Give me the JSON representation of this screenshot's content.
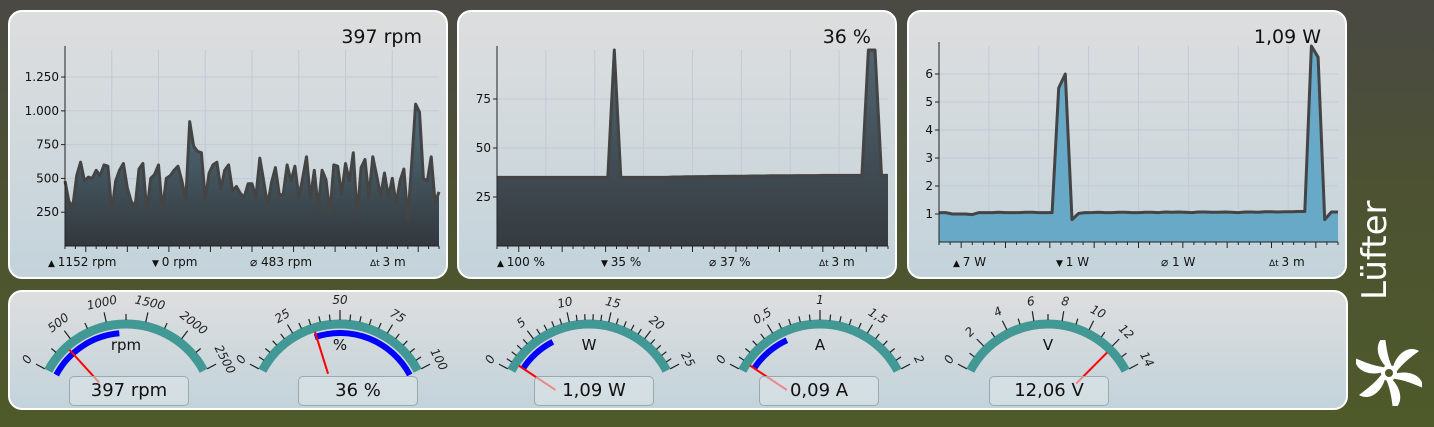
{
  "section_title": "Lüfter",
  "charts": [
    {
      "current": "397 rpm",
      "stats": {
        "max": "1152 rpm",
        "min": "0 rpm",
        "avg": "483 rpm",
        "span": "3 m"
      },
      "chart_data": {
        "type": "area",
        "ylim": [
          0,
          1450
        ],
        "yticks": [
          250,
          500,
          750,
          1000,
          1250
        ],
        "ytick_labels": [
          "250",
          "500",
          "750",
          "1.000",
          "1.250"
        ],
        "fill": [
          "#52707f",
          "#33383c"
        ],
        "values": [
          480,
          330,
          290,
          520,
          620,
          480,
          510,
          500,
          560,
          520,
          600,
          590,
          250,
          480,
          560,
          610,
          430,
          330,
          290,
          570,
          610,
          250,
          500,
          530,
          600,
          260,
          500,
          520,
          560,
          590,
          480,
          340,
          920,
          740,
          700,
          690,
          340,
          540,
          600,
          620,
          420,
          560,
          600,
          410,
          440,
          390,
          360,
          460,
          460,
          360,
          650,
          480,
          300,
          470,
          580,
          380,
          380,
          600,
          480,
          590,
          360,
          500,
          660,
          350,
          560,
          280,
          560,
          490,
          240,
          600,
          590,
          380,
          610,
          480,
          690,
          220,
          580,
          640,
          360,
          660,
          520,
          370,
          540,
          360,
          500,
          310,
          480,
          570,
          200,
          610,
          1050,
          990,
          500,
          480,
          660,
          320,
          400
        ]
      }
    },
    {
      "current": "36 %",
      "stats": {
        "max": "100 %",
        "min": "35 %",
        "avg": "37 %",
        "span": "3 m"
      },
      "chart_data": {
        "type": "area",
        "ylim": [
          0,
          100
        ],
        "yticks": [
          25,
          50,
          75
        ],
        "ytick_labels": [
          "25",
          "50",
          "75"
        ],
        "fill": [
          "#4f6572",
          "#363b3f"
        ],
        "values": [
          35,
          35,
          35,
          35,
          35,
          35,
          35,
          35,
          35,
          35,
          35,
          35,
          35,
          35,
          35,
          35,
          35,
          35,
          100,
          35,
          35,
          35,
          35,
          35,
          35,
          35,
          35,
          35.2,
          35.2,
          35.3,
          35.3,
          35.4,
          35.4,
          35.5,
          35.5,
          35.5,
          35.6,
          35.6,
          35.6,
          35.7,
          35.7,
          35.7,
          35.8,
          35.8,
          35.8,
          35.8,
          35.9,
          35.9,
          35.9,
          35.9,
          36,
          36,
          36,
          36,
          36,
          36,
          36,
          100,
          100,
          36,
          36
        ]
      }
    },
    {
      "current": "1,09 W",
      "stats": {
        "max": "7 W",
        "min": "1 W",
        "avg": "1 W",
        "span": "3 m"
      },
      "chart_data": {
        "type": "area",
        "ylim": [
          0,
          7
        ],
        "yticks": [
          1,
          2,
          3,
          4,
          5,
          6
        ],
        "ytick_labels": [
          "1",
          "2",
          "3",
          "4",
          "5",
          "6"
        ],
        "fill": [
          "#68a9c8",
          "#68a9c8"
        ],
        "values": [
          1.05,
          1.05,
          1,
          1,
          1,
          0.98,
          1.05,
          1.05,
          1.05,
          1.06,
          1.05,
          1.05,
          1.05,
          1.06,
          1.06,
          1.05,
          1.05,
          1.05,
          5.5,
          6,
          0.8,
          1.02,
          1.05,
          1.05,
          1.06,
          1.05,
          1.05,
          1.06,
          1.06,
          1.05,
          1.05,
          1.06,
          1.06,
          1.05,
          1.07,
          1.06,
          1.07,
          1.06,
          1.05,
          1.07,
          1.07,
          1.06,
          1.06,
          1.07,
          1.06,
          1.05,
          1.07,
          1.07,
          1.06,
          1.08,
          1.08,
          1.07,
          1.08,
          1.08,
          1.09,
          1.09,
          7,
          6.6,
          0.8,
          1.07,
          1.07
        ]
      }
    }
  ],
  "gauges": [
    {
      "unit": "rpm",
      "value_label": "397 rpm",
      "min": 0,
      "max": 2500,
      "value": 397,
      "range": [
        0,
        1152
      ],
      "major": [
        0,
        500,
        1000,
        1500,
        2000,
        2500
      ],
      "major_labels": [
        "0",
        "500",
        "1000",
        "1500",
        "2000",
        "2500"
      ],
      "minor_per_major": 2
    },
    {
      "unit": "%",
      "value_label": "36 %",
      "min": 0,
      "max": 100,
      "value": 36,
      "range": [
        35,
        100
      ],
      "major": [
        0,
        25,
        50,
        75,
        100
      ],
      "major_labels": [
        "0",
        "25",
        "50",
        "75",
        "100"
      ],
      "minor_per_major": 5
    },
    {
      "unit": "W",
      "value_label": "1,09 W",
      "min": 0,
      "max": 25,
      "value": 1.09,
      "range": [
        1,
        7
      ],
      "major": [
        0,
        5,
        10,
        15,
        20,
        25
      ],
      "major_labels": [
        "0",
        "5",
        "10",
        "15",
        "20",
        "25"
      ],
      "minor_per_major": 5
    },
    {
      "unit": "A",
      "value_label": "0,09 A",
      "min": 0,
      "max": 2,
      "value": 0.09,
      "range": [
        0.09,
        0.6
      ],
      "major": [
        0,
        0.5,
        1,
        1.5,
        2
      ],
      "major_labels": [
        "0",
        "0,5",
        "1",
        "1,5",
        "2"
      ],
      "minor_per_major": 5
    },
    {
      "unit": "V",
      "value_label": "12,06 V",
      "min": 0,
      "max": 14,
      "value": 12.06,
      "range": [
        12,
        12.1
      ],
      "major": [
        0,
        2,
        4,
        6,
        8,
        10,
        12,
        14
      ],
      "major_labels": [
        "0",
        "2",
        "4",
        "6",
        "8",
        "10",
        "12",
        "14"
      ],
      "minor_per_major": 2
    }
  ],
  "colors": {
    "gauge_arc": "#429894",
    "gauge_range": "#0000ff",
    "needle": "#ff0000",
    "line": "#444444"
  }
}
